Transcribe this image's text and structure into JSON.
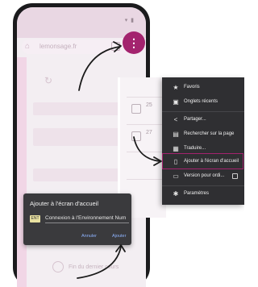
{
  "browser": {
    "url": "lemonsage.fr",
    "home_icon": "home-icon",
    "tabs_icon": "tabs-icon",
    "menu_icon": "kebab-menu-icon",
    "accent_color": "#a3236e"
  },
  "menu": {
    "items": [
      {
        "icon": "star-icon",
        "label": "Favoris"
      },
      {
        "icon": "recent-tabs-icon",
        "label": "Onglets récents"
      },
      {
        "icon": "share-icon",
        "label": "Partager..."
      },
      {
        "icon": "find-in-page-icon",
        "label": "Rechercher sur la page"
      },
      {
        "icon": "translate-icon",
        "label": "Traduire..."
      },
      {
        "icon": "add-to-home-icon",
        "label": "Ajouter à l'écran d'accueil",
        "highlighted": true
      },
      {
        "icon": "desktop-icon",
        "label": "Version pour ordi...",
        "checkbox": true
      },
      {
        "icon": "settings-icon",
        "label": "Paramètres"
      }
    ]
  },
  "dialog": {
    "title": "Ajouter à l'écran d'accueil",
    "input_value": "Connexion à l'Environnement Num",
    "cancel_label": "Annuler",
    "add_label": "Ajouter"
  },
  "background": {
    "footer_text": "Fin du dernier cours"
  },
  "zoom_panel": {
    "rows": [
      {
        "num": "25",
        "sub": ""
      },
      {
        "num": "27",
        "sub": ""
      },
      {
        "num": "",
        "sub": ""
      },
      {
        "num": "",
        "sub": ""
      }
    ]
  }
}
